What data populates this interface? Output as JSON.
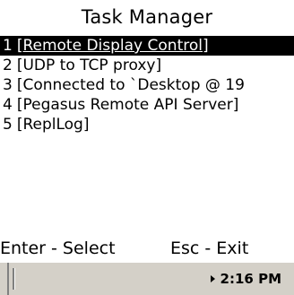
{
  "window": {
    "title": "Task Manager"
  },
  "tasks": [
    {
      "number": "1",
      "label": "[Remote Display Control]",
      "selected": true
    },
    {
      "number": "2",
      "label": "[UDP to TCP proxy]",
      "selected": false
    },
    {
      "number": "3",
      "label": "[Connected to `Desktop @ 19",
      "selected": false
    },
    {
      "number": "4",
      "label": "[Pegasus Remote API Server]",
      "selected": false
    },
    {
      "number": "5",
      "label": "[ReplLog]",
      "selected": false
    }
  ],
  "softkeys": {
    "left": "Enter - Select",
    "right": "Esc - Exit"
  },
  "taskbar": {
    "clock": "2:16 PM",
    "tray_icon": "expand-arrow-icon"
  }
}
